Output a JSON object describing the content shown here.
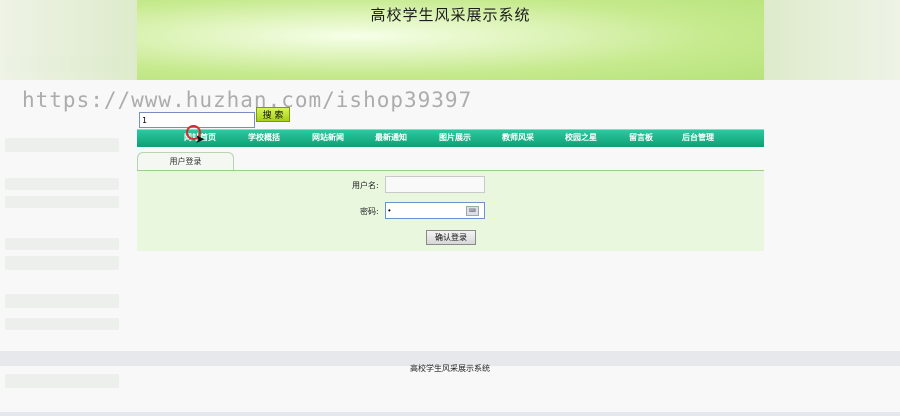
{
  "header": {
    "title": "高校学生风采展示系统"
  },
  "watermark": "https://www.huzhan.com/ishop39397",
  "search": {
    "value": "1",
    "button_label": "搜 索"
  },
  "nav": {
    "items": [
      "网站首页",
      "学校概括",
      "网站新闻",
      "最新通知",
      "图片展示",
      "教师风采",
      "校园之星",
      "留言板",
      "后台管理"
    ]
  },
  "login": {
    "tab_label": "用户登录",
    "username_label": "用户名:",
    "username_value": "",
    "password_label": "密码:",
    "password_value": "•",
    "confirm_label": "确认登录"
  },
  "footer": {
    "text": "高校学生风采展示系统"
  },
  "colors": {
    "nav": "#14a87b",
    "banner": "#c6ea8e",
    "panel": "#e8f7de"
  }
}
